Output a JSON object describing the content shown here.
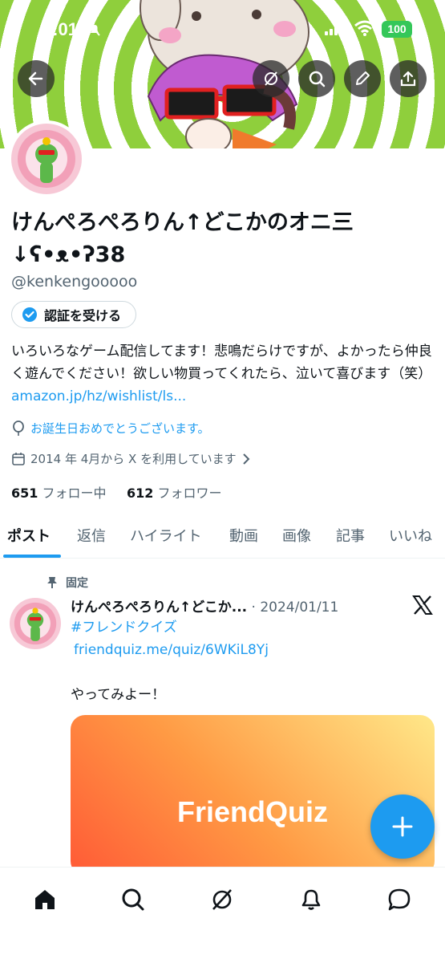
{
  "status_bar": {
    "time": "0:01",
    "battery": "100"
  },
  "profile": {
    "name_line1": "けんぺろぺろりん↑どこかのオニ三",
    "name_line2": "↓ʕ•ᴥ•ʔ38",
    "handle": "@kenkengooooo",
    "verify_label": "認証を受ける",
    "bio": "いろいろなゲーム配信してます！悲鳴だらけですが、よかったら仲良く遊んでください！欲しい物買ってくれたら、泣いて喜びます（笑）",
    "bio_link": "amazon.jp/hz/wishlist/ls...",
    "birthday": "お誕生日おめでとうございます。",
    "joined": "2014 年 4月から X を利用しています",
    "following_count": "651",
    "following_label": "フォロー中",
    "followers_count": "612",
    "followers_label": "フォロワー"
  },
  "tabs": [
    {
      "label": "ポスト"
    },
    {
      "label": "返信"
    },
    {
      "label": "ハイライト"
    },
    {
      "label": "動画"
    },
    {
      "label": "画像"
    },
    {
      "label": "記事"
    },
    {
      "label": "いいね"
    }
  ],
  "post": {
    "pinned_label": "固定",
    "author": "けんぺろぺろりん↑どこか...",
    "date": "· 2024/01/11",
    "hashtag": "#フレンドクイズ",
    "link": "friendquiz.me/quiz/6WKiL8Yj",
    "text": "やってみよー！",
    "card_title": "FriendQuiz"
  },
  "colors": {
    "accent": "#1d9bf0",
    "text": "#0f1419",
    "secondary": "#536471",
    "banner_green": "#8fcf3c"
  }
}
